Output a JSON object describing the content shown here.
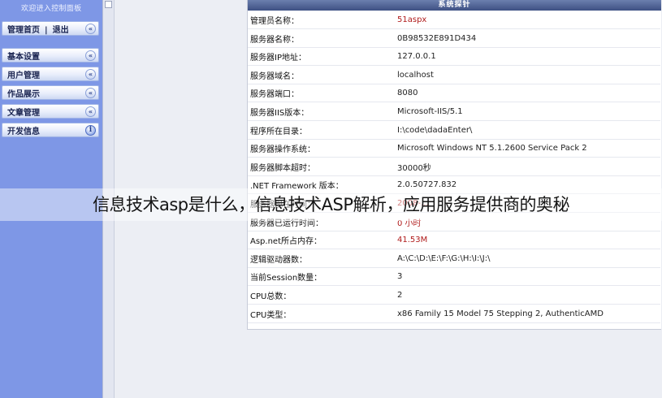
{
  "sidebar": {
    "header": "欢迎进入控制面板",
    "top": {
      "home": "管理首页",
      "separator": "|",
      "logout": "退出",
      "collapse": "«"
    },
    "items": [
      {
        "label": "基本设置",
        "control": "«"
      },
      {
        "label": "用户管理",
        "control": "«"
      },
      {
        "label": "作品展示",
        "control": "«"
      },
      {
        "label": "文章管理",
        "control": "«"
      },
      {
        "label": "开发信息",
        "control": "i"
      }
    ]
  },
  "panel": {
    "title": "系统探针",
    "rows": [
      {
        "label": "管理员名称：",
        "value": "51aspx"
      },
      {
        "label": "服务器名称：",
        "value": "0B98532E891D434"
      },
      {
        "label": "服务器IP地址：",
        "value": "127.0.0.1"
      },
      {
        "label": "服务器域名：",
        "value": "localhost"
      },
      {
        "label": "服务器端口：",
        "value": "8080"
      },
      {
        "label": "服务器IIS版本：",
        "value": "Microsoft-IIS/5.1"
      },
      {
        "label": "程序所在目录：",
        "value": "I:\\code\\dadaEnter\\"
      },
      {
        "label": "服务器操作系统：",
        "value": "Microsoft Windows NT 5.1.2600 Service Pack 2"
      },
      {
        "label": "服务器脚本超时：",
        "value": "30000秒"
      },
      {
        "label": ".NET Framework 版本：",
        "value": "2.0.50727.832"
      },
      {
        "label": "服务器现在时间：",
        "value": "2008-..."
      },
      {
        "label": "服务器已运行时间：",
        "value": "0 小时"
      },
      {
        "label": "Asp.net所占内存：",
        "value": "41.53M"
      },
      {
        "label": "逻辑驱动器数：",
        "value": "A:\\C:\\D:\\E:\\F:\\G:\\H:\\I:\\J:\\"
      },
      {
        "label": "当前Session数量：",
        "value": "3"
      },
      {
        "label": "CPU总数：",
        "value": "2"
      },
      {
        "label": "CPU类型：",
        "value": "x86 Family 15 Model 75 Stepping 2, AuthenticAMD"
      }
    ]
  },
  "caption": "信息技术asp是什么，信息技术ASP解析，应用服务提供商的奥秘",
  "watermark": "..."
}
